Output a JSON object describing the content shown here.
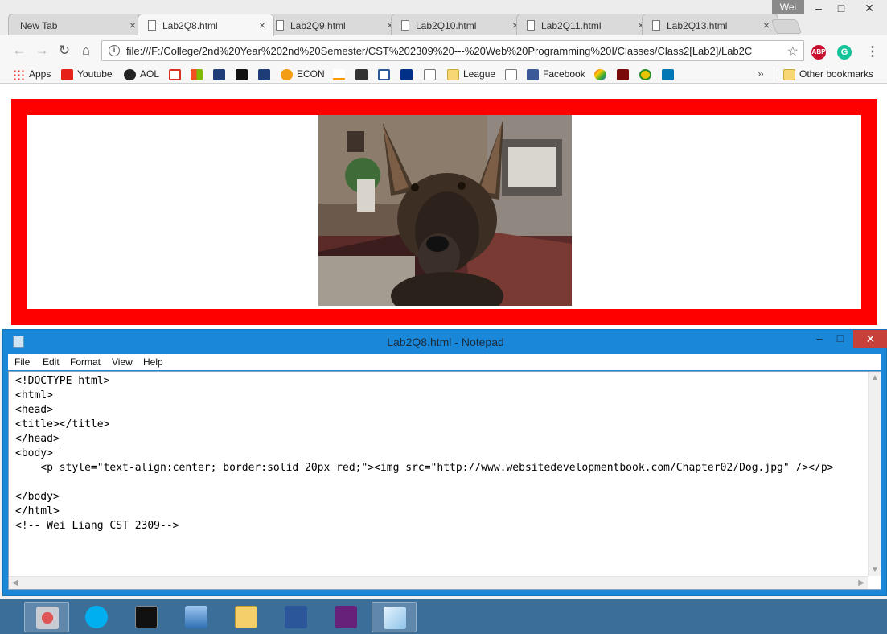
{
  "browser": {
    "profile_name": "Wei",
    "tabs": [
      {
        "label": "New Tab",
        "close": "×"
      },
      {
        "label": "Lab2Q8.html",
        "close": "×"
      },
      {
        "label": "Lab2Q9.html",
        "close": "×"
      },
      {
        "label": "Lab2Q10.html",
        "close": "×"
      },
      {
        "label": "Lab2Q11.html",
        "close": "×"
      },
      {
        "label": "Lab2Q13.html",
        "close": "×"
      }
    ],
    "window_controls": {
      "minimize": "–",
      "maximize": "□",
      "close": "✕"
    },
    "url": "file:///F:/College/2nd%20Year%202nd%20Semester/CST%202309%20---%20Web%20Programming%20I/Classes/Class2[Lab2]/Lab2C",
    "nav": {
      "back": "←",
      "forward": "→",
      "reload": "↻",
      "home": "⌂",
      "star": "☆",
      "menu": "⋮"
    },
    "extensions": {
      "adblock": "ABP",
      "grammarly": "G"
    },
    "bookmarks": {
      "apps": "Apps",
      "youtube": "Youtube",
      "aol": "AOL",
      "econ": "ECON",
      "league": "League",
      "facebook": "Facebook",
      "overflow": "»",
      "other": "Other bookmarks"
    }
  },
  "notepad": {
    "title": "Lab2Q8.html - Notepad",
    "controls": {
      "minimize": "–",
      "maximize": "□",
      "close": "✕"
    },
    "menu": [
      "File",
      "Edit",
      "Format",
      "View",
      "Help"
    ],
    "lines": [
      "<!DOCTYPE html>",
      "<html>",
      "<head>",
      "<title></title>",
      "</head>",
      "<body>",
      "    <p style=\"text-align:center; border:solid 20px red;\"><img src=\"http://www.websitedevelopmentbook.com/Chapter02/Dog.jpg\" /></p>",
      "",
      "</body>",
      "</html>",
      "<!-- Wei Liang CST 2309-->"
    ]
  },
  "colors": {
    "page_border": "#ff0000",
    "notepad_frame": "#1b87d8",
    "taskbar": "#3c6e9a",
    "close_red": "#c7413a"
  }
}
